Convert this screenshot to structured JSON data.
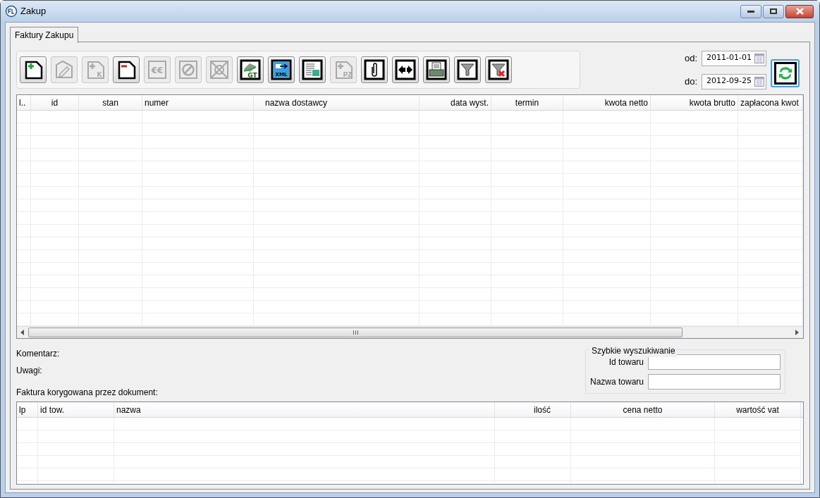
{
  "window": {
    "title": "Zakup"
  },
  "tabs": [
    {
      "label": "Faktury Zakupu",
      "selected": true
    }
  ],
  "toolbar": [
    {
      "kind": "add",
      "disabled": false
    },
    {
      "kind": "edit",
      "disabled": true
    },
    {
      "kind": "add-letter",
      "mark": "K",
      "disabled": true
    },
    {
      "kind": "remove",
      "disabled": false
    },
    {
      "kind": "currency",
      "mark": "€€",
      "disabled": true
    },
    {
      "kind": "cancel",
      "disabled": true
    },
    {
      "kind": "cross",
      "disabled": true
    },
    {
      "kind": "disk",
      "mark": "GT",
      "disabled": false
    },
    {
      "kind": "export",
      "mark": "XML",
      "disabled": false
    },
    {
      "kind": "sheet",
      "disabled": false
    },
    {
      "kind": "add-letter",
      "mark": "PZ",
      "disabled": true
    },
    {
      "kind": "clip",
      "disabled": false
    },
    {
      "kind": "swap",
      "disabled": false
    },
    {
      "kind": "print",
      "disabled": false
    },
    {
      "kind": "filter",
      "disabled": false
    },
    {
      "kind": "filter-clear",
      "disabled": false
    }
  ],
  "date_from": {
    "label": "od:",
    "value": "2011-01-01"
  },
  "date_to": {
    "label": "do:",
    "value": "2012-09-25"
  },
  "invoices_table": {
    "columns": [
      "l..",
      "id",
      "stan",
      "numer",
      "nazwa dostawcy",
      "data wyst.",
      "termin",
      "kwota netto",
      "kwota brutto",
      "zapłacona kwot"
    ]
  },
  "details": {
    "comment_label": "Komentarz:",
    "notes_label": "Uwagi:",
    "corrected_label": "Faktura korygowana przez dokument:"
  },
  "quick_search": {
    "title": "Szybkie wyszukiwanie",
    "fields": [
      {
        "label": "Id towaru"
      },
      {
        "label": "Nazwa towaru"
      }
    ]
  },
  "items_table": {
    "columns": [
      "lp",
      "id tow.",
      "nazwa",
      "ilość",
      "cena netto",
      "wartość vat"
    ]
  }
}
